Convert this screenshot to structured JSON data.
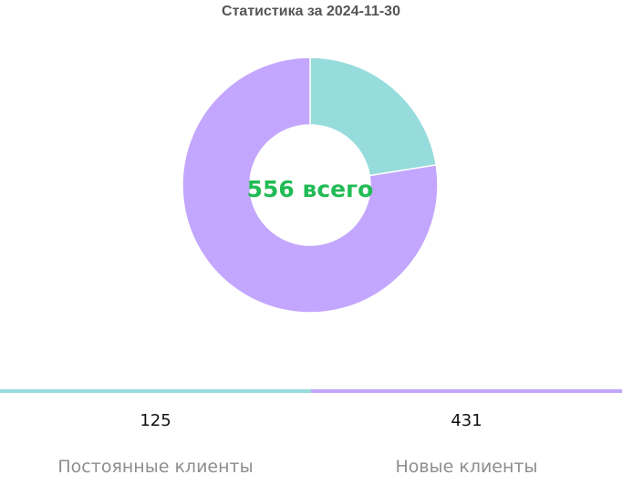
{
  "chart_data": {
    "type": "pie",
    "title": "Статистика за 2024-11-30",
    "center_label": "556 всего",
    "total": 556,
    "series": [
      {
        "name": "Постоянные клиенты",
        "value": 125,
        "color": "#97dcdc"
      },
      {
        "name": "Новые клиенты",
        "value": 431,
        "color": "#c3a6fd"
      }
    ],
    "center_label_color": "#22bb55",
    "legend_placement": "bottom"
  },
  "legend": [
    {
      "value": "125",
      "label": "Постоянные клиенты"
    },
    {
      "value": "431",
      "label": "Новые клиенты"
    }
  ]
}
